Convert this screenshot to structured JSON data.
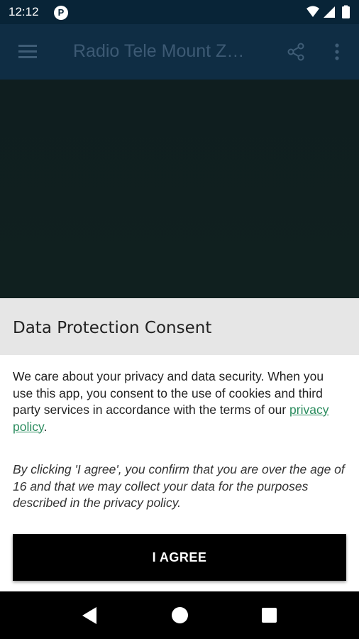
{
  "status_bar": {
    "time": "12:12",
    "badge": "P",
    "icons": [
      "wifi-icon",
      "signal-icon",
      "battery-icon"
    ]
  },
  "app_bar": {
    "title": "Radio Tele Mount Z…",
    "icons": [
      "menu-icon",
      "share-icon",
      "more-vert-icon"
    ],
    "color": "#0f2d44"
  },
  "consent": {
    "title": "Data Protection Consent",
    "body_text": "We care about your privacy and data security. When you use this app, you consent to the use of cookies and third party services in accordance with the terms of our ",
    "link_text": "privacy policy",
    "body_end": ".",
    "italic_text": "By clicking 'I agree', you confirm that you are over the age of 16 and that we may collect your data for the purposes described in the privacy policy.",
    "button_label": "I AGREE",
    "link_color": "#2b8c5e"
  },
  "nav_bar": {
    "icons": [
      "back-icon",
      "home-icon",
      "recents-icon"
    ]
  }
}
